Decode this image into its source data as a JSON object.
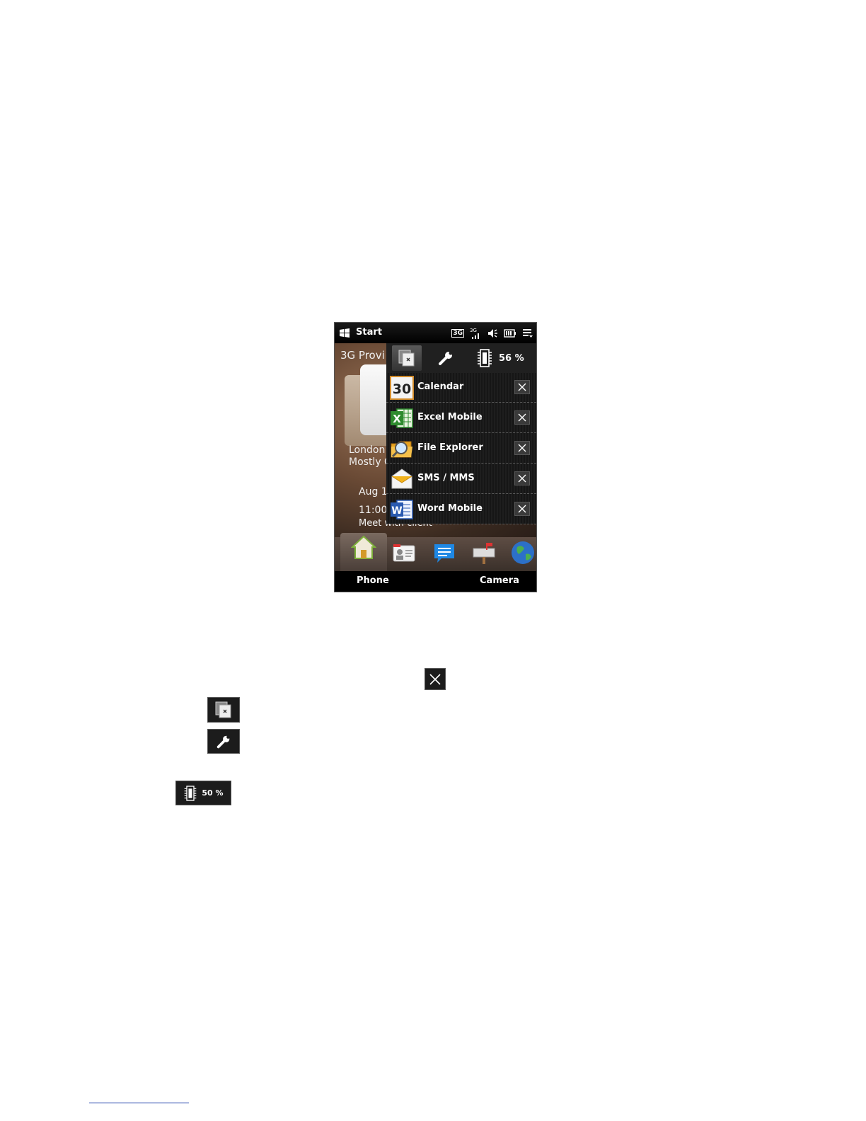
{
  "statusbar": {
    "start_label": "Start",
    "network_badge": "3G",
    "signal_badge": "3G",
    "icons": [
      "windows-flag-icon",
      "network-3g-icon",
      "signal-strength-icon",
      "speaker-muted-icon",
      "battery-icon",
      "menu-icon"
    ]
  },
  "home": {
    "provider": "3G Provi",
    "weather_city": "London",
    "weather_condition": "Mostly C",
    "calendar_date": "Aug 1",
    "calendar_time": "11:00",
    "calendar_event": "Meet with client"
  },
  "task_manager": {
    "memory_label": "56 %",
    "tasks": [
      {
        "label": "Calendar",
        "icon": "calendar-icon",
        "icon_text": "30"
      },
      {
        "label": "Excel Mobile",
        "icon": "excel-icon",
        "icon_text": "X"
      },
      {
        "label": "File Explorer",
        "icon": "file-explorer-icon",
        "icon_text": ""
      },
      {
        "label": "SMS / MMS",
        "icon": "sms-icon",
        "icon_text": ""
      },
      {
        "label": "Word Mobile",
        "icon": "word-icon",
        "icon_text": "W"
      }
    ]
  },
  "dock": {
    "icons": [
      "home-icon",
      "contacts-icon",
      "messages-icon",
      "mail-icon",
      "internet-icon"
    ]
  },
  "softkeys": {
    "left": "Phone",
    "right": "Camera"
  },
  "standalone": {
    "memory_label": "50 %"
  },
  "colors": {
    "panel_bg": "#1e1e1e",
    "excel_green": "#2e8b2e",
    "word_blue": "#2a5ab0",
    "folder_orange": "#e6a21e",
    "sms_yellow": "#f2b21c",
    "message_blue": "#1e88e5"
  }
}
